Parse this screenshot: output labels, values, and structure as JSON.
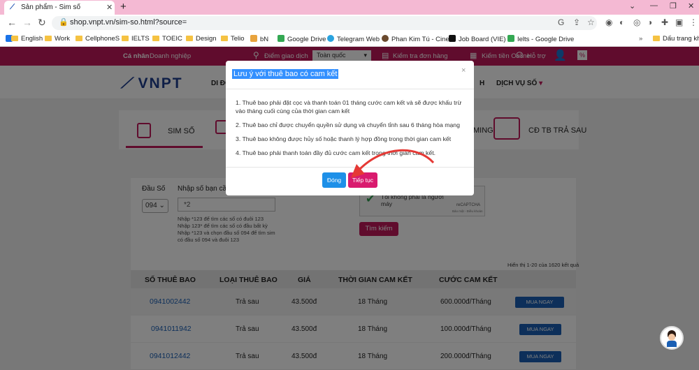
{
  "browser": {
    "tab_title": "Sản phẩm - Sim số",
    "url": "shop.vnpt.vn/sim-so.html?source=",
    "bookmarks": [
      "English",
      "Work",
      "CellphoneS",
      "IELTS",
      "TOEIC",
      "Design",
      "Telio",
      "bN",
      "Google Drive",
      "Telegram Web",
      "Phan Kim Tú - Cine...",
      "Job Board (VIE)",
      "Ielts - Google Drive"
    ],
    "bookmarks_more": "Dấu trang khác"
  },
  "site": {
    "top_links": {
      "personal": "Cá nhân",
      "business": "Doanh nghiệp",
      "store": "Điểm giao dịch",
      "region": "Toàn quốc",
      "order_check": "Kiểm tra đơn hàng",
      "online_money": "Kiểm tiền Online",
      "support": "Hỗ trợ"
    },
    "logo": "VNPT",
    "menu": {
      "first": "DI ĐỘ",
      "h": "H",
      "services": "DỊCH VỤ SỐ"
    },
    "product_tabs": {
      "sim": "SIM SỐ",
      "roaming": "MING",
      "postpaid": "CĐ TB TRẢ SAU"
    },
    "search": {
      "prefix_label": "Đầu Số",
      "prefix_value": "094",
      "number_label": "Nhập số bạn cần",
      "number_value": "*2",
      "hints": [
        "Nhập *123 để tìm các số có đuôi 123",
        "Nhập 123* để tìm các số có đầu bất kỳ",
        "Nhập *123 và chọn đầu số 094 để tìm sim",
        "có đầu số 094 và đuôi 123"
      ],
      "captcha_text": "Tôi không phải là người máy",
      "captcha_brand": "reCAPTCHA",
      "captcha_links": "Bảo mật - Điều khoản",
      "search_button": "Tìm kiếm"
    },
    "result_count": "Hiển thị 1-20 của 1620 kết quả",
    "table": {
      "headers": [
        "SỐ THUÊ BAO",
        "LOẠI THUÊ BAO",
        "GIÁ",
        "THỜI GIAN CAM KẾT",
        "CƯỚC CAM KẾT"
      ],
      "rows": [
        {
          "number": "0941002442",
          "type": "Trả sau",
          "price": "43.500đ",
          "commit_time": "18 Tháng",
          "commit_fee": "600.000đ/Tháng",
          "action": "MUA NGAY"
        },
        {
          "number": "0941011942",
          "type": "Trả sau",
          "price": "43.500đ",
          "commit_time": "18 Tháng",
          "commit_fee": "100.000đ/Tháng",
          "action": "MUA NGAY"
        },
        {
          "number": "0941012442",
          "type": "Trả sau",
          "price": "43.500đ",
          "commit_time": "18 Tháng",
          "commit_fee": "200.000đ/Tháng",
          "action": "MUA NGAY"
        }
      ]
    }
  },
  "modal": {
    "title": "Lưu ý với thuê bao có cam kết",
    "lines": [
      "1. Thuê bao phải đặt cọc và thanh toán 01 tháng cước cam kết và sẽ được khấu trừ",
      "vào tháng cuối cùng của thời gian cam kết",
      "2. Thuê bao chỉ được chuyển quyền sử dụng và chuyển tỉnh sau 6 tháng hòa mạng",
      "3. Thuê bao không được hủy số hoặc thanh lý hợp đồng trong thời gian cam kết",
      "4. Thuê bao phải thanh toán đầy đủ cước cam kết trong thời gian cam kết."
    ],
    "close_button": "Đóng",
    "continue_button": "Tiếp tục"
  },
  "colors": {
    "brand": "#c0185a",
    "blue": "#1a5fb4",
    "annotation": "#e53935"
  }
}
